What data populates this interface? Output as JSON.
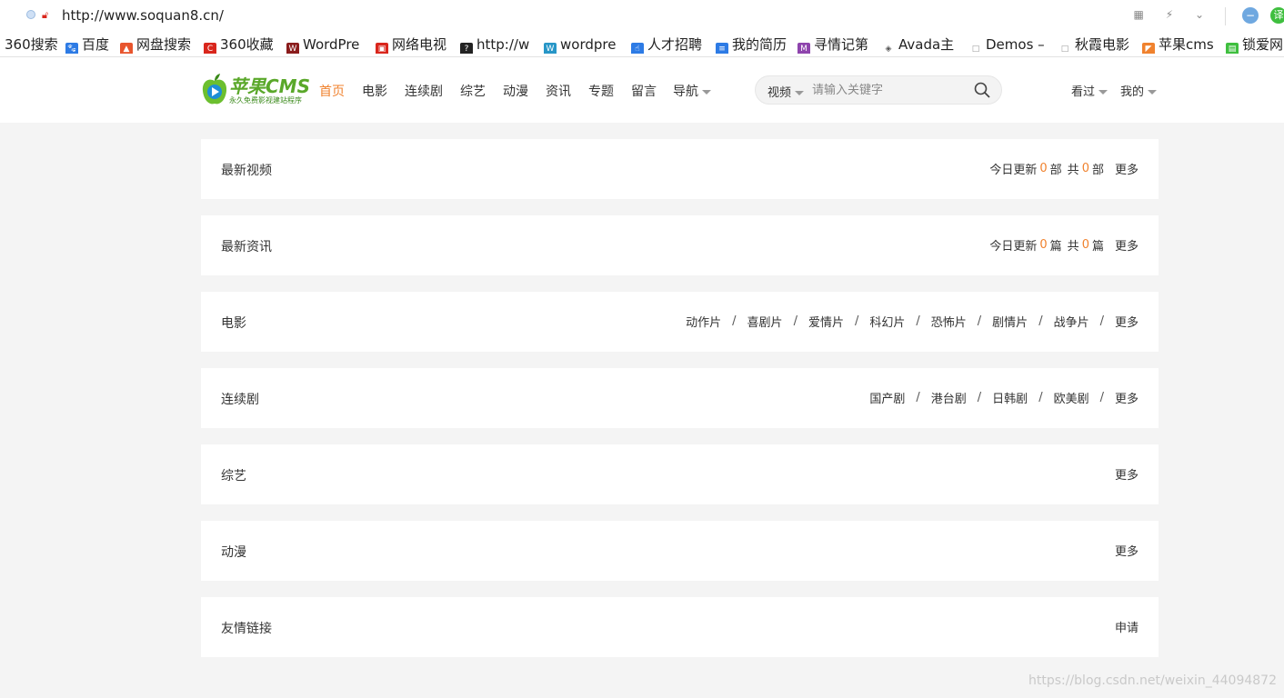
{
  "browser": {
    "url": "http://www.soquan8.cn/",
    "bookmarks": [
      {
        "label": "360搜索",
        "icon": "none",
        "color": ""
      },
      {
        "label": "百度",
        "icon": "baidu-paw-icon",
        "color": "#2d7be5"
      },
      {
        "label": "网盘搜索",
        "icon": "flame-icon",
        "color": "#e8552d"
      },
      {
        "label": "360收藏",
        "icon": "c-logo-icon",
        "color": "#d9261c"
      },
      {
        "label": "WordPre",
        "icon": "wp-logo-icon",
        "color": "#8a1c1c"
      },
      {
        "label": "网络电视",
        "icon": "tv-icon",
        "color": "#d9261c"
      },
      {
        "label": "http://w",
        "icon": "arrow-circle-icon",
        "color": "#222222"
      },
      {
        "label": "wordpre",
        "icon": "wordpress-icon",
        "color": "#2796c7"
      },
      {
        "label": "人才招聘",
        "icon": "hand-icon",
        "color": "#2d7be5"
      },
      {
        "label": "我的简历",
        "icon": "resume-icon",
        "color": "#2d7be5"
      },
      {
        "label": "寻情记第",
        "icon": "m-logo-icon",
        "color": "#8e44ad"
      },
      {
        "label": "Avada主",
        "icon": "diamond-icon",
        "color": "#555555"
      },
      {
        "label": "Demos –",
        "icon": "page-icon",
        "color": "#999999"
      },
      {
        "label": "秋霞电影",
        "icon": "page-icon",
        "color": "#999999"
      },
      {
        "label": "苹果cms",
        "icon": "flag-icon",
        "color": "#f0822e"
      },
      {
        "label": "锁爱网",
        "icon": "green-logo-icon",
        "color": "#3fbf3f"
      }
    ]
  },
  "header": {
    "logo": {
      "name": "苹果CMS",
      "tagline": "永久免费影视建站程序"
    },
    "nav": [
      {
        "label": "首页",
        "active": true
      },
      {
        "label": "电影"
      },
      {
        "label": "连续剧"
      },
      {
        "label": "综艺"
      },
      {
        "label": "动漫"
      },
      {
        "label": "资讯"
      },
      {
        "label": "专题"
      },
      {
        "label": "留言"
      },
      {
        "label": "导航",
        "dropdown": true
      }
    ],
    "search": {
      "type_label": "视频",
      "placeholder": "请输入关键字"
    },
    "watched_label": "看过",
    "mine_label": "我的"
  },
  "sections": [
    {
      "title": "最新视频",
      "stats": {
        "today_label": "今日更新",
        "today": "0",
        "unit": "部",
        "total_label": "共",
        "total": "0"
      },
      "more": "更多"
    },
    {
      "title": "最新资讯",
      "stats": {
        "today_label": "今日更新",
        "today": "0",
        "unit": "篇",
        "total_label": "共",
        "total": "0"
      },
      "more": "更多"
    },
    {
      "title": "电影",
      "links": [
        "动作片",
        "喜剧片",
        "爱情片",
        "科幻片",
        "恐怖片",
        "剧情片",
        "战争片"
      ],
      "more": "更多"
    },
    {
      "title": "连续剧",
      "links": [
        "国产剧",
        "港台剧",
        "日韩剧",
        "欧美剧"
      ],
      "more": "更多"
    },
    {
      "title": "综艺",
      "more": "更多"
    },
    {
      "title": "动漫",
      "more": "更多"
    },
    {
      "title": "友情链接",
      "more": "申请"
    }
  ],
  "watermark": "https://blog.csdn.net/weixin_44094872",
  "colors": {
    "accent": "#f0822e",
    "logo_green": "#5aa82a",
    "page_bg": "#f4f4f4"
  }
}
